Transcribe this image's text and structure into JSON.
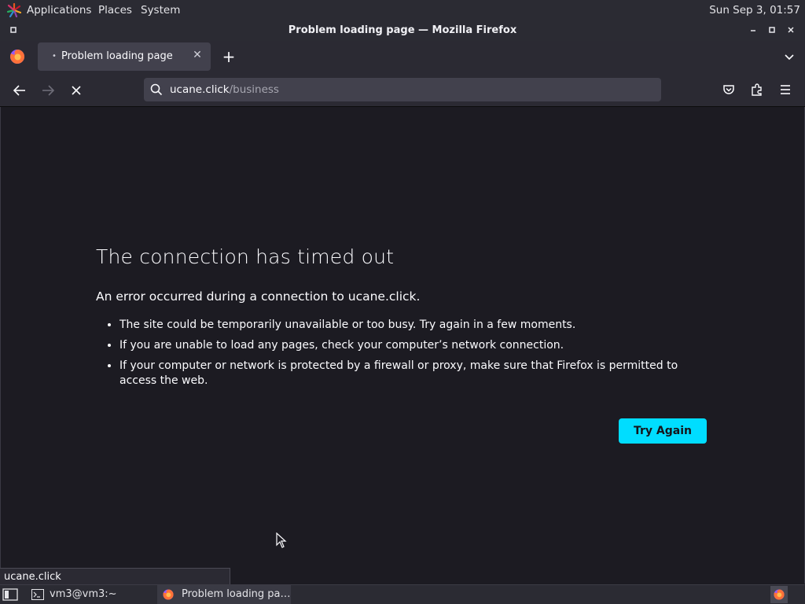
{
  "system_panel": {
    "menus": [
      "Applications",
      "Places",
      "System"
    ],
    "clock": "Sun Sep  3, 01:57"
  },
  "window": {
    "title": "Problem loading page — Mozilla Firefox"
  },
  "tabs": [
    {
      "label": "Problem loading page",
      "active": true
    }
  ],
  "urlbar": {
    "host": "ucane.click",
    "path": "/business"
  },
  "error_page": {
    "title": "The connection has timed out",
    "description": "An error occurred during a connection to ucane.click.",
    "bullets": [
      "The site could be temporarily unavailable or too busy. Try again in a few moments.",
      "If you are unable to load any pages, check your computer’s network connection.",
      "If your computer or network is protected by a firewall or proxy, make sure that Firefox is permitted to access the web."
    ],
    "try_again_label": "Try Again",
    "accent_color": "#00ddff"
  },
  "status_link": "ucane.click",
  "taskbar": {
    "tasks": [
      {
        "label": "vm3@vm3:~",
        "icon": "terminal-icon"
      },
      {
        "label": "Problem loading pa…",
        "icon": "firefox-icon",
        "active": true
      }
    ]
  },
  "colors": {
    "page_bg": "#1c1b22",
    "toolbar_bg": "#2b2a33",
    "urlbar_bg": "#42414d",
    "button_accent": "#00ddff"
  }
}
